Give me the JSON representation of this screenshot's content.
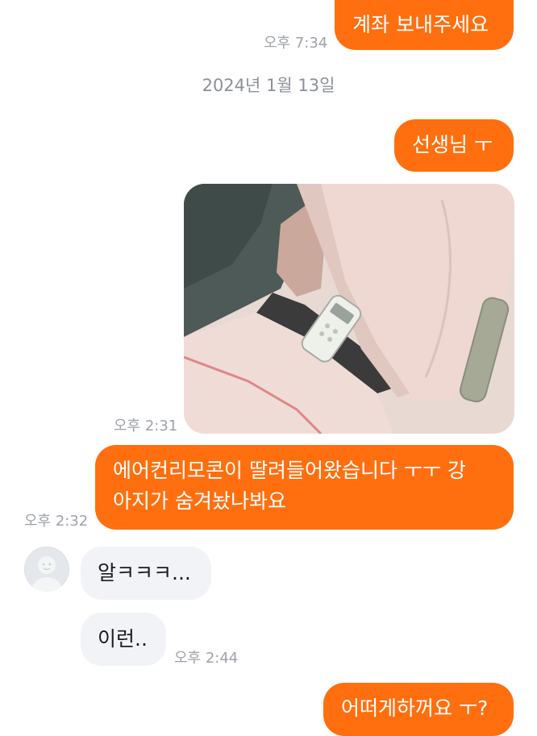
{
  "date_divider": "2024년 1월 13일",
  "messages": [
    {
      "text": "계좌 보내주세요",
      "time": "오후 7:34"
    },
    {
      "text": "선생님 ㅜ"
    },
    {
      "time": "오후 2:31",
      "image": "remote-control-under-blanket"
    },
    {
      "line1": "에어컨리모콘이 딸려들어왔습니다 ㅜㅜ 강",
      "line2": "아지가 숨겨놨나봐요",
      "time": "오후 2:32"
    },
    {
      "text": "알ㅋㅋㅋ..."
    },
    {
      "text": "이런..",
      "time": "오후 2:44"
    },
    {
      "text": "어떠게하꺼요 ㅜ?"
    }
  ],
  "colors": {
    "sent": "#ff6f0f",
    "received": "#f2f3f6",
    "time": "#9ea3ab"
  }
}
